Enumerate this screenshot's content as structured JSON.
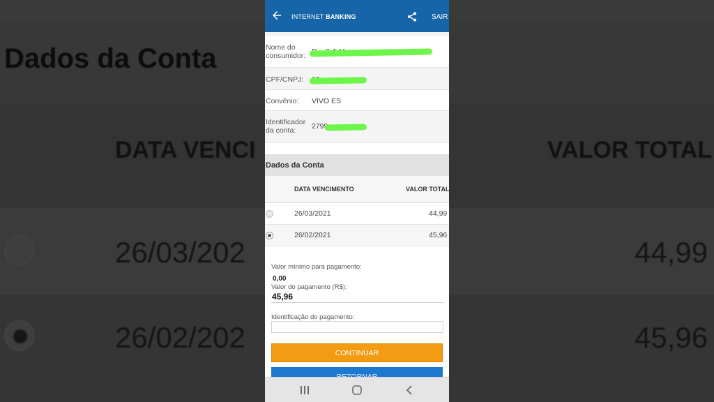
{
  "background": {
    "section_title": "Dados da Conta",
    "col_date": "DATA VENCI",
    "col_total": "VALOR TOTAL",
    "rows": [
      {
        "date": "26/03/202",
        "value": "44,99"
      },
      {
        "date": "26/02/202",
        "value": "45,96"
      }
    ]
  },
  "appbar": {
    "title_light": "INTERNET",
    "title_bold": "BANKING",
    "exit_label": "SAIR"
  },
  "info": {
    "consumer_label": "Nome do consumidor:",
    "consumer_value": "R... S.A.M...",
    "doc_label": "CPF/CNPJ:",
    "doc_value": "12",
    "agreement_label": "Convênio:",
    "agreement_value": "VIVO ES",
    "account_id_label": "Identificador da conta:",
    "account_id_value": "2799"
  },
  "account": {
    "section_title": "Dados da Conta",
    "col_date": "DATA VENCIMENTO",
    "col_total": "VALOR TOTAL",
    "rows": [
      {
        "date": "26/03/2021",
        "value": "44,99",
        "selected": false
      },
      {
        "date": "26/02/2021",
        "value": "45,96",
        "selected": true
      }
    ]
  },
  "payment": {
    "min_label": "Valor mínimo para pagamento:",
    "min_value": "0,00",
    "amount_label": "Valor do pagamento (R$):",
    "amount_value": "45,96",
    "id_label": "Identificação do pagamento:",
    "id_value": ""
  },
  "buttons": {
    "continue_label": "CONTINUAR",
    "return_label": "RETORNAR"
  },
  "colors": {
    "appbar": "#1565a8",
    "continue": "#f29b13",
    "return": "#1d7ad0",
    "redaction": "#6df54a"
  },
  "icons": [
    "arrow-back-icon",
    "share-icon",
    "recents-icon",
    "home-icon",
    "back-icon"
  ]
}
